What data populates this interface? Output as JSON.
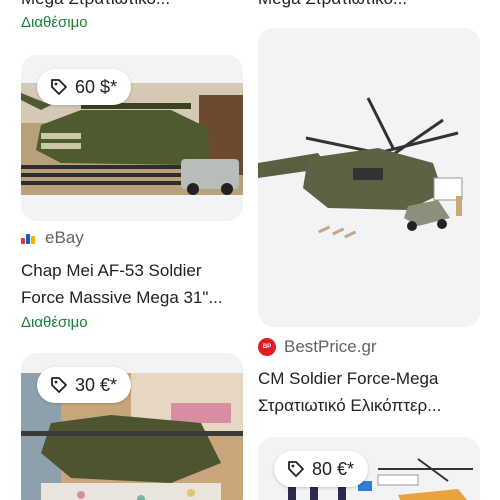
{
  "top": {
    "left_title_fragment": "Mega Στρατιωτικό...",
    "left_availability": "Διαθέσιμο",
    "right_title_fragment": "Mega Στρατιωτικό..."
  },
  "items": [
    {
      "price": "60 $*",
      "source": "eBay",
      "title_line1": "Chap Mei AF-53 Soldier",
      "title_line2": "Force Massive Mega 31\"...",
      "availability": "Διαθέσιμο"
    },
    {
      "source": "BestPrice.gr",
      "title_line1": "CM Soldier Force-Mega",
      "title_line2": "Στρατιωτικό Ελικόπτερ..."
    },
    {
      "price": "30 €*"
    },
    {
      "price": "80 €*"
    }
  ],
  "colors": {
    "availability": "#188038",
    "secondary_text": "#5f6368",
    "bestprice_brand": "#e31b23"
  },
  "icons": {
    "price_tag": "tag-icon",
    "ebay": "ebay-favicon",
    "bestprice": "bestprice-favicon"
  }
}
